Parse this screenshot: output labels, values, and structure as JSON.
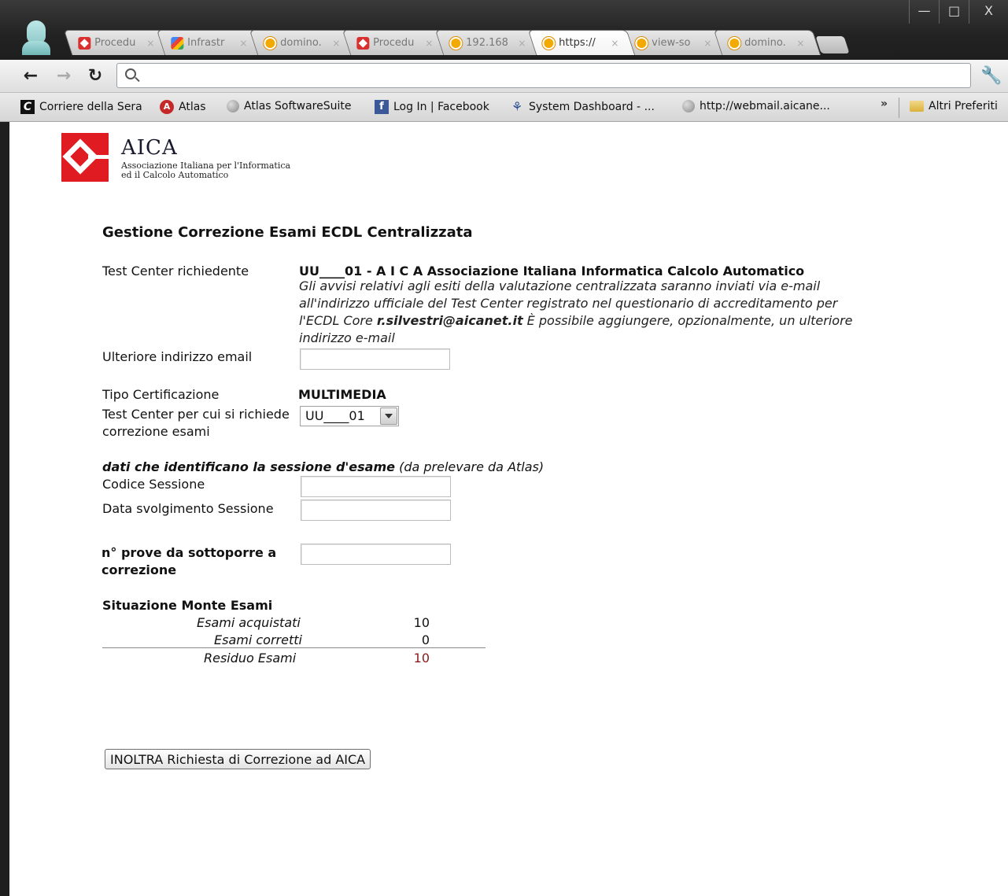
{
  "browser": {
    "tabs": [
      {
        "label": "Procedu",
        "favicon": "aica-icon"
      },
      {
        "label": "Infrastr",
        "favicon": "google-icon"
      },
      {
        "label": "domino.",
        "favicon": "domino-icon"
      },
      {
        "label": "Procedu",
        "favicon": "aica-icon"
      },
      {
        "label": "192.168",
        "favicon": "domino-icon"
      },
      {
        "label": "https://",
        "favicon": "domino-icon",
        "active": true
      },
      {
        "label": "view-so",
        "favicon": "domino-icon"
      },
      {
        "label": "domino.",
        "favicon": "domino-icon"
      }
    ],
    "tab_close_glyph": "×",
    "window_buttons": {
      "minimize": "—",
      "maximize": "□",
      "close": "X"
    },
    "address_bar": {
      "value": "",
      "placeholder": ""
    },
    "bookmarks": [
      {
        "label": "Corriere della Sera",
        "icon": "corriere-icon"
      },
      {
        "label": "Atlas",
        "icon": "atlas-icon"
      },
      {
        "label": "Atlas SoftwareSuite",
        "icon": "globe-icon"
      },
      {
        "label": "Log In | Facebook",
        "icon": "facebook-icon"
      },
      {
        "label": "System Dashboard - ...",
        "icon": "dashboard-icon"
      },
      {
        "label": "http://webmail.aicane...",
        "icon": "globe-icon"
      }
    ],
    "bookmarks_overflow": "»",
    "other_bookmarks": "Altri Preferiti"
  },
  "logo": {
    "name": "AICA",
    "subtitle_line1": "Associazione Italiana per l'Informatica",
    "subtitle_line2": "ed il Calcolo Automatico"
  },
  "form": {
    "title": "Gestione Correzione Esami ECDL Centralizzata",
    "test_center_label": "Test Center richiedente",
    "test_center_value": "UU____01 - A I C A Associazione Italiana Informatica Calcolo Automatico",
    "notice_part1": "Gli avvisi relativi agli esiti della valutazione centralizzata saranno inviati via e-mail all'indirizzo ufficiale del Test Center registrato nel questionario di accreditamento per l'ECDL Core ",
    "notice_email": "r.silvestri@aicanet.it",
    "notice_part2": " È possibile aggiungere, opzionalmente, un ulteriore indirizzo e-mail",
    "extra_email_label": "Ulteriore indirizzo email",
    "extra_email_value": "",
    "cert_type_label": "Tipo Certificazione",
    "cert_type_value": "MULTIMEDIA",
    "tc_request_label_line1": "Test Center per cui si richiede",
    "tc_request_label_line2": "correzione esami",
    "tc_request_selected": "UU____01",
    "session_heading_bold": "dati che identificano la sessione d'esame",
    "session_heading_rest": " (da prelevare da Atlas)",
    "session_code_label": "Codice Sessione",
    "session_code_value": "",
    "session_date_label": "Data svolgimento Sessione",
    "session_date_value": "",
    "tests_count_label_line1": "n° prove da sottoporre a",
    "tests_count_label_line2": "correzione",
    "tests_count_value": "",
    "monte_title": "Situazione Monte Esami",
    "monte_rows": [
      {
        "label": "Esami acquistati",
        "value": "10"
      },
      {
        "label": "Esami corretti",
        "value": "0"
      },
      {
        "label": "Residuo Esami",
        "value": "10"
      }
    ],
    "submit_label": "INOLTRA Richiesta di Correzione ad AICA"
  },
  "colors": {
    "brand_red": "#e11b22",
    "residuo_value": "#8b1a1a"
  }
}
